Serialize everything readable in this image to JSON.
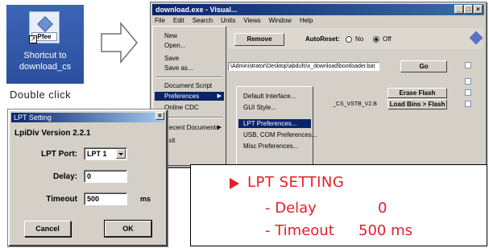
{
  "shortcut": {
    "icon_name": "shortcut-file-icon",
    "tile_text": "Pfee",
    "caption": "Shortcut to download_cs"
  },
  "instruction": "Double click",
  "arrow_icon": "right-arrow-icon",
  "main_window": {
    "title": "download.exe - Visual...",
    "menu": [
      "File",
      "Edit",
      "Search",
      "Units",
      "Views",
      "Window",
      "Help"
    ],
    "toolbar": {
      "button_label": "Remove",
      "radio_label": "AutoReset:",
      "radio_no": "No",
      "radio_off": "Off",
      "path_value": "\\Administrator\\Desktop\\abdufs\\x_download\\bootloader.bat",
      "go_label": "Go",
      "erase_label": "Erase Flash",
      "load_label": "Load Bins > Flash",
      "partial_path": "_CS_VSTB_V2.B"
    },
    "file_menu": [
      "New",
      "Open...",
      "Save",
      "Save as...",
      "Document Script",
      "Preferences",
      "Online CDC",
      "Recent Documents",
      "Exit"
    ],
    "file_menu_selected": "Preferences",
    "preferences_submenu": [
      "Default Interface...",
      "GUI Style...",
      "LPT Preferences...",
      "USB, COM Preferences...",
      "Misc Preferences..."
    ],
    "submenu_selected": "LPT Preferences..."
  },
  "dialog": {
    "title": "LPT Setting",
    "version": "LpiDiv Version 2.2.1",
    "lpt_port_label": "LPT Port:",
    "lpt_port_value": "LPT 1",
    "delay_label": "Delay:",
    "delay_value": "0",
    "timeout_label": "Timeout",
    "timeout_value": "500",
    "timeout_unit": "ms",
    "cancel_label": "Cancel",
    "ok_label": "OK"
  },
  "note": {
    "title": "LPT SETTING",
    "delay_label": "- Delay",
    "delay_value": "0",
    "timeout_label": "- Timeout",
    "timeout_value": "500 ms",
    "accent_color": "#e4202a"
  }
}
